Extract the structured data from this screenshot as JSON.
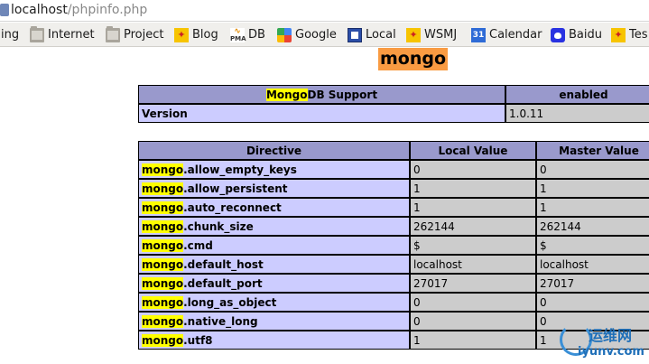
{
  "browser": {
    "url_host": "localhost",
    "url_path": "/phpinfo.php",
    "bookmarks": [
      {
        "label": "ing",
        "icon": "none"
      },
      {
        "label": "Internet",
        "icon": "folder-icon"
      },
      {
        "label": "Project",
        "icon": "folder-icon"
      },
      {
        "label": "Blog",
        "icon": "yellow-bookmark-icon"
      },
      {
        "label": "DB",
        "icon": "phpmyadmin-icon"
      },
      {
        "label": "Google",
        "icon": "google-icon"
      },
      {
        "label": "Local",
        "icon": "local-icon"
      },
      {
        "label": "WSMJ",
        "icon": "yellow-bookmark-icon"
      },
      {
        "label": "Calendar",
        "icon": "calendar-icon",
        "icon_text": "31"
      },
      {
        "label": "Baidu",
        "icon": "baidu-paw-icon"
      },
      {
        "label": "Tes",
        "icon": "yellow-bookmark-icon"
      }
    ],
    "pma_icon_text": [
      "PMA"
    ]
  },
  "module": {
    "heading": "mongo",
    "support_table": {
      "header_highlight": "Mongo",
      "header_rest": "DB Support",
      "header_status": "enabled",
      "version_label": "Version",
      "version_value": "1.0.11"
    },
    "directive_table": {
      "headers": [
        "Directive",
        "Local Value",
        "Master Value"
      ],
      "prefix": "mongo",
      "rows": [
        {
          "suffix": ".allow_empty_keys",
          "local": "0",
          "master": "0"
        },
        {
          "suffix": ".allow_persistent",
          "local": "1",
          "master": "1"
        },
        {
          "suffix": ".auto_reconnect",
          "local": "1",
          "master": "1"
        },
        {
          "suffix": ".chunk_size",
          "local": "262144",
          "master": "262144"
        },
        {
          "suffix": ".cmd",
          "local": "$",
          "master": "$"
        },
        {
          "suffix": ".default_host",
          "local": "localhost",
          "master": "localhost"
        },
        {
          "suffix": ".default_port",
          "local": "27017",
          "master": "27017"
        },
        {
          "suffix": ".long_as_object",
          "local": "0",
          "master": "0"
        },
        {
          "suffix": ".native_long",
          "local": "0",
          "master": "0"
        },
        {
          "suffix": ".utf8",
          "local": "1",
          "master": "1"
        }
      ]
    }
  },
  "watermark": {
    "name": "运维网",
    "url": "iyunv.com"
  },
  "colors": {
    "heading_bg": "#f99b42",
    "header_bg": "#9999cc",
    "name_cell_bg": "#ccccff",
    "value_cell_bg": "#cccccc",
    "highlight": "#ffff00"
  }
}
